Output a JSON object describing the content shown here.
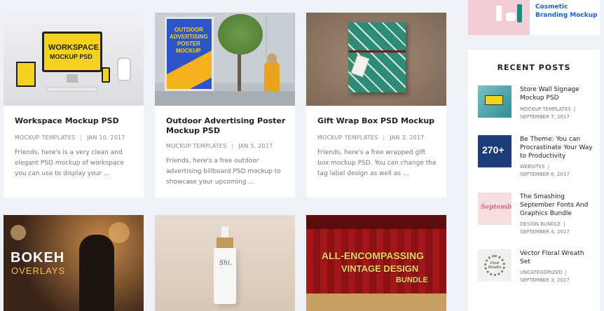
{
  "posts": [
    {
      "title": "Workspace Mockup PSD",
      "category": "MOCKUP TEMPLATES",
      "date": "JAN 10, 2017",
      "excerpt": "Friends, here's is a very clean and elegant PSD mockup of workspace you can use to display your …",
      "thumb_line1": "WORKSPACE",
      "thumb_line2": "MOCKUP PSD"
    },
    {
      "title": "Outdoor Advertising Poster Mockup PSD",
      "category": "MOCKUP TEMPLATES",
      "date": "JAN 5, 2017",
      "excerpt": "Friends, here's a free outdoor advertising billboard PSD mockup to showcase your upcoming …",
      "thumb_line1": "OUTDOOR",
      "thumb_line2": "ADVERTISING",
      "thumb_line3": "POSTER",
      "thumb_line4": "MOCKUP"
    },
    {
      "title": "Gift Wrap Box PSD Mockup",
      "category": "MOCKUP TEMPLATES",
      "date": "JAN 3, 2017",
      "excerpt": "Friends, here's a free wrapped gift box mockup PSD. You can change the tag label design as well as …"
    }
  ],
  "bottom_cards": [
    {
      "line1": "BOKEH",
      "line2": "OVERLAYS"
    },
    {
      "bottle_label": "Shi."
    },
    {
      "line1": "ALL-ENCOMPASSING",
      "line2": "VINTAGE DESIGN",
      "line3": "BUNDLE"
    }
  ],
  "sidebar": {
    "ad_link": "Cosmetic Branding Mockup",
    "recent_heading": "RECENT POSTS",
    "recent": [
      {
        "title": "Store Wall Signage Mockup PSD",
        "category": "MOCKUP TEMPLATES",
        "date": "SEPTEMBER 7, 2017"
      },
      {
        "title": "Be Theme: You can Procrastinate Your Way to Productivity",
        "category": "WEBSITES",
        "date": "SEPTEMBER 6, 2017",
        "thumb_text": "270+"
      },
      {
        "title": "The Smashing September Fonts And Graphics Bundle",
        "category": "DESIGN BUNDLE",
        "date": "SEPTEMBER 4, 2017",
        "thumb_text": "September"
      },
      {
        "title": "Vector Floral Wreath Set",
        "category": "UNCATEGORIZED",
        "date": "SEPTEMBER 3, 2017",
        "thumb_text": "Floral Wreaths"
      }
    ]
  },
  "colors": {
    "link": "#1a5fd6",
    "accent_yellow": "#f5d21e"
  }
}
